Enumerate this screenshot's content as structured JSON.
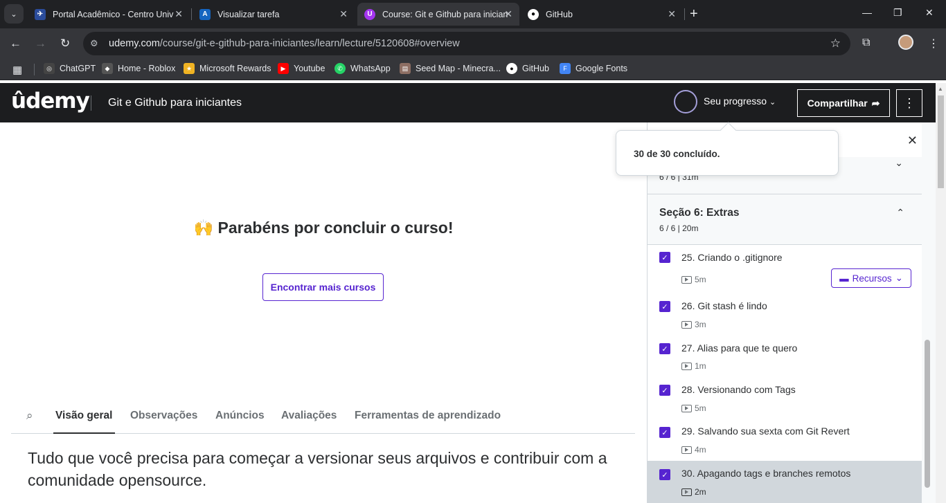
{
  "browser": {
    "tabs": [
      {
        "title": "Portal Acadêmico - Centro Univ",
        "favicon_color": "#2b4c9b",
        "favicon_glyph": "✈"
      },
      {
        "title": "Visualizar tarefa",
        "favicon_color": "#1565c0",
        "favicon_glyph": "A"
      },
      {
        "title": "Course: Git e Github para inician",
        "favicon_color": "#a435f0",
        "favicon_glyph": "U"
      },
      {
        "title": "GitHub",
        "favicon_color": "#000000",
        "favicon_glyph": "●"
      }
    ],
    "url_domain": "udemy.com",
    "url_path": "/course/git-e-github-para-iniciantes/learn/lecture/5120608#overview",
    "bookmarks": [
      {
        "label": "ChatGPT",
        "color": "#444444"
      },
      {
        "label": "Home - Roblox",
        "color": "#555555"
      },
      {
        "label": "Microsoft Rewards",
        "color": "#f0b323"
      },
      {
        "label": "Youtube",
        "color": "#ff0000"
      },
      {
        "label": "WhatsApp",
        "color": "#25d366"
      },
      {
        "label": "Seed Map - Minecra...",
        "color": "#8d6e63"
      },
      {
        "label": "GitHub",
        "color": "#000000"
      },
      {
        "label": "Google Fonts",
        "color": "#4285f4"
      }
    ]
  },
  "header": {
    "logo": "ûdemy",
    "course_title": "Git e Github para iniciantes",
    "progress_label": "Seu progresso",
    "share_label": "Compartilhar"
  },
  "main": {
    "congrats": "🙌 Parabéns por concluir o curso!",
    "find_more": "Encontrar mais cursos",
    "tabs": [
      "Visão geral",
      "Observações",
      "Anúncios",
      "Avaliações",
      "Ferramentas de aprendizado"
    ],
    "description": "Tudo que você precisa para começar a versionar seus arquivos e contribuir com a comunidade opensource."
  },
  "popover": {
    "text": "30 de 30 concluído."
  },
  "sidebar": {
    "prev_section_meta": "6 / 6 | 31m",
    "section": {
      "name": "Seção 6: Extras",
      "meta": "6 / 6 | 20m"
    },
    "resources_label": "Recursos",
    "lectures": [
      {
        "title": "25. Criando o .gitignore",
        "duration": "5m",
        "completed": true
      },
      {
        "title": "26. Git stash é lindo",
        "duration": "3m",
        "completed": true
      },
      {
        "title": "27. Alias para que te quero",
        "duration": "1m",
        "completed": true
      },
      {
        "title": "28. Versionando com Tags",
        "duration": "5m",
        "completed": true
      },
      {
        "title": "29. Salvando sua sexta com Git Revert",
        "duration": "4m",
        "completed": true
      },
      {
        "title": "30. Apagando tags e branches remotos",
        "duration": "2m",
        "completed": true
      }
    ]
  }
}
